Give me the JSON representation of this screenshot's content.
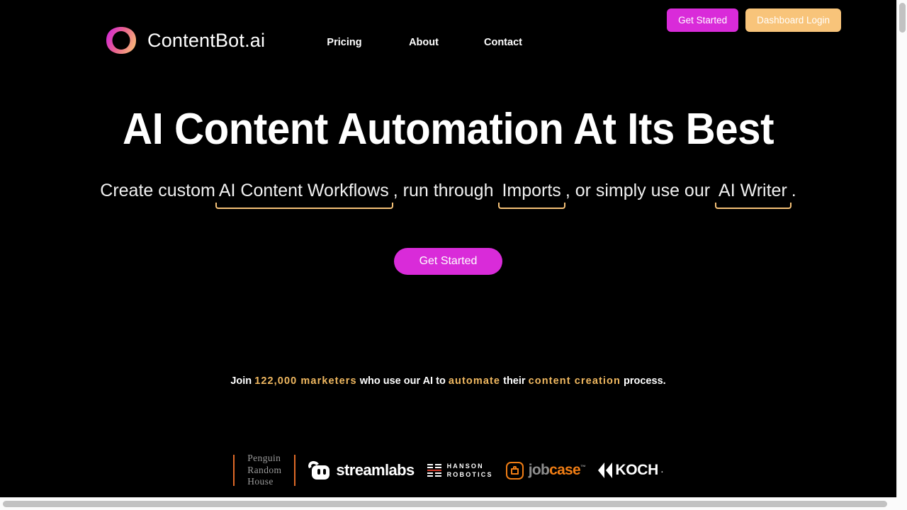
{
  "header": {
    "brand_name": "ContentBot.ai",
    "logo_icon": "gradient-ring-icon",
    "nav": [
      {
        "label": "Pricing"
      },
      {
        "label": "About"
      },
      {
        "label": "Contact"
      }
    ],
    "actions": [
      {
        "label": "Get Started",
        "color": "#d92bd9"
      },
      {
        "label": "Dashboard Login",
        "color": "#f8c47a"
      }
    ]
  },
  "hero": {
    "title": "AI Content Automation At Its Best",
    "subtitle_parts": [
      {
        "text": "Create custom",
        "highlight": false
      },
      {
        "text": "AI Content Workflows",
        "highlight": true
      },
      {
        "text": ", run through",
        "highlight": false
      },
      {
        "text": "Imports",
        "highlight": true
      },
      {
        "text": ", or simply use our",
        "highlight": false
      },
      {
        "text": "AI Writer",
        "highlight": true
      },
      {
        "text": ".",
        "highlight": false
      }
    ],
    "cta_label": "Get Started",
    "cta_color": "#d92bd9",
    "underline_color": "#f5c177"
  },
  "stats": {
    "prefix": "Join ",
    "count": "122,000 marketers",
    "middle1": " who use our AI to ",
    "word1": "automate",
    "middle2": " their ",
    "word2": "content creation",
    "suffix": " process.",
    "accent_color": "#f0b860"
  },
  "logos": [
    {
      "name": "Penguin Random House",
      "line1": "Penguin",
      "line2": "Random",
      "line3": "House"
    },
    {
      "name": "streamlabs",
      "wordmark": "streamlabs"
    },
    {
      "name": "Hanson Robotics",
      "line1": "HANSON",
      "line2": "ROBOTICS"
    },
    {
      "name": "jobcase",
      "part1": "job",
      "part2": "case",
      "tm": "™"
    },
    {
      "name": "KOCH",
      "wordmark": "KOCH",
      "period": "."
    }
  ],
  "scrollbars": {
    "vertical_position": "top",
    "horizontal_position": "left"
  }
}
